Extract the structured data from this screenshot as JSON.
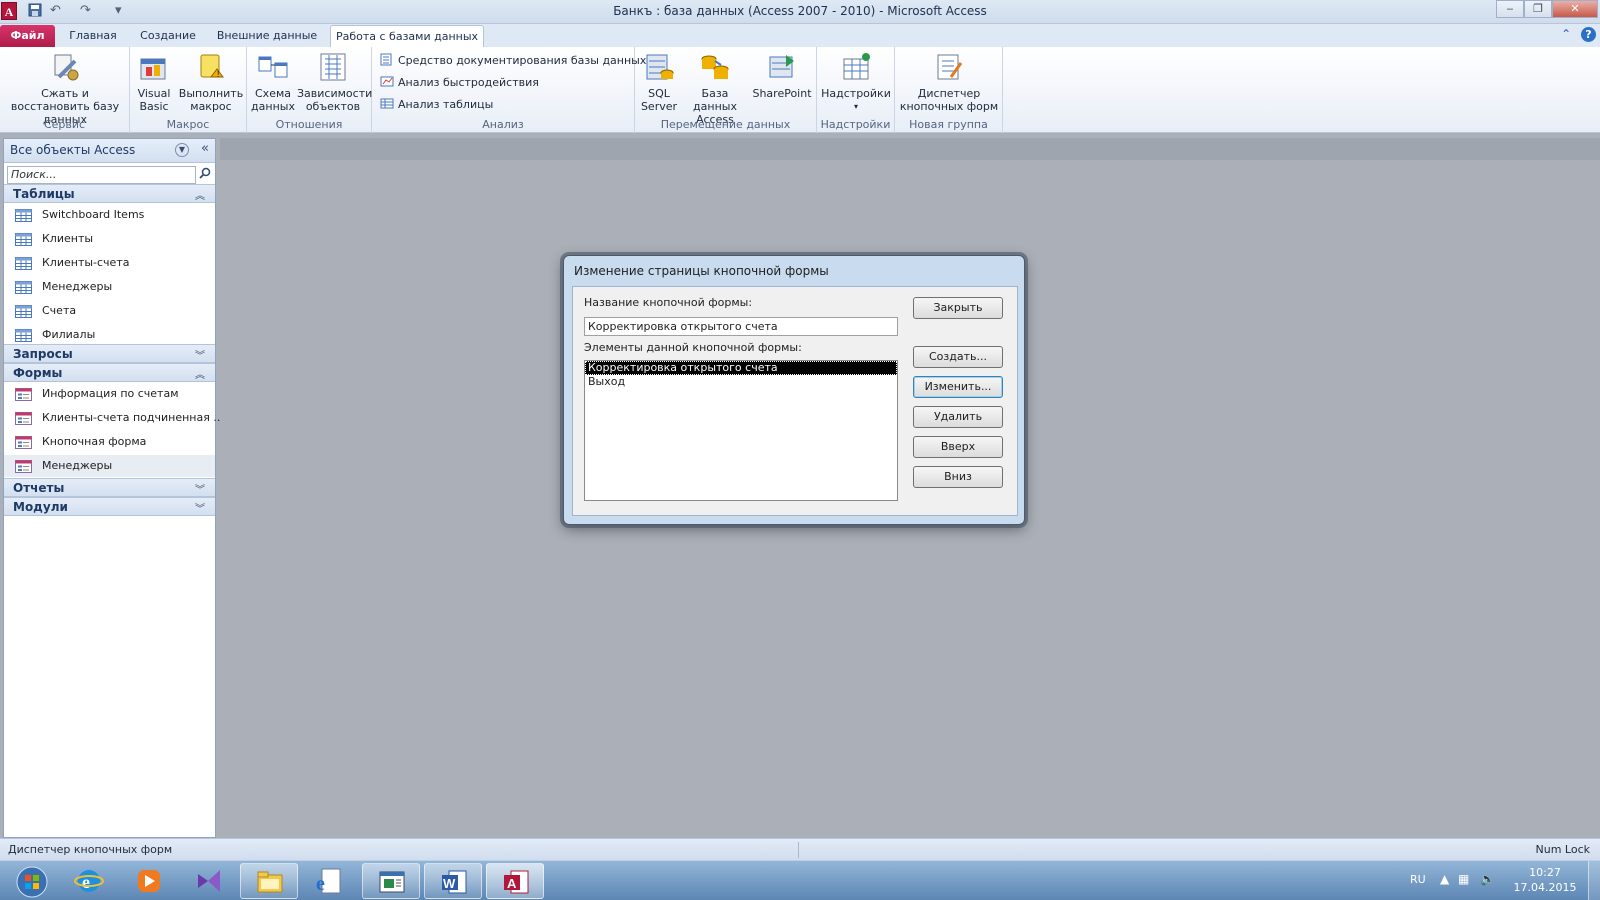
{
  "window": {
    "title": "Банкъ : база данных (Access 2007 - 2010)  -  Microsoft Access",
    "app_icon": "A",
    "controls": {
      "minimize": "‒",
      "restore": "❐",
      "close": "✕"
    }
  },
  "quick_access": {
    "save": "💾",
    "undo": "↶",
    "redo": "↷",
    "customize": "▾"
  },
  "ribbon_tabs": [
    {
      "label": "Файл"
    },
    {
      "label": "Главная"
    },
    {
      "label": "Создание"
    },
    {
      "label": "Внешние данные"
    },
    {
      "label": "Работа с базами данных"
    }
  ],
  "ribbon": {
    "groups": [
      {
        "label": "Сервис",
        "buttons": [
          {
            "label": "Сжать и восстановить базу данных"
          }
        ]
      },
      {
        "label": "Макрос",
        "buttons": [
          {
            "label": "Visual Basic"
          },
          {
            "label": "Выполнить макрос"
          }
        ]
      },
      {
        "label": "Отношения",
        "buttons": [
          {
            "label": "Схема данных"
          },
          {
            "label": "Зависимости объектов"
          }
        ]
      },
      {
        "label": "Анализ",
        "items": [
          {
            "label": "Средство документирования базы данных"
          },
          {
            "label": "Анализ быстродействия"
          },
          {
            "label": "Анализ таблицы"
          }
        ]
      },
      {
        "label": "Перемещение данных",
        "buttons": [
          {
            "label": "SQL Server"
          },
          {
            "label": "База данных Access"
          },
          {
            "label": "SharePoint"
          }
        ]
      },
      {
        "label": "Надстройки",
        "buttons": [
          {
            "label": "Надстройки"
          }
        ]
      },
      {
        "label": "Новая группа",
        "buttons": [
          {
            "label": "Диспетчер кнопочных форм"
          }
        ]
      }
    ]
  },
  "nav_pane": {
    "title": "Все объекты Access",
    "search_placeholder": "Поиск...",
    "sections": [
      {
        "label": "Таблицы",
        "expanded": true,
        "items": [
          "Switchboard Items",
          "Клиенты",
          "Клиенты-счета",
          "Менеджеры",
          "Счета",
          "Филиалы"
        ]
      },
      {
        "label": "Запросы",
        "expanded": false,
        "items": []
      },
      {
        "label": "Формы",
        "expanded": true,
        "items": [
          "Информация по счетам",
          "Клиенты-счета подчиненная ...",
          "Кнопочная форма",
          "Менеджеры"
        ]
      },
      {
        "label": "Отчеты",
        "expanded": false,
        "items": []
      },
      {
        "label": "Модули",
        "expanded": false,
        "items": []
      }
    ],
    "selected_item": "Менеджеры"
  },
  "dialog": {
    "title": "Изменение страницы кнопочной формы",
    "name_label": "Название кнопочной формы:",
    "name_value": "Корректировка открытого счета",
    "items_label": "Элементы данной кнопочной формы:",
    "items": [
      "Корректировка открытого счета",
      "Выход"
    ],
    "selected_index": 0,
    "buttons": {
      "close": "Закрыть",
      "create": "Создать...",
      "edit": "Изменить...",
      "delete": "Удалить",
      "up": "Вверх",
      "down": "Вниз"
    }
  },
  "status_bar": {
    "left": "Диспетчер кнопочных форм",
    "right": "Num Lock"
  },
  "taskbar": {
    "lang": "RU",
    "time": "10:27",
    "date": "17.04.2015"
  },
  "icons": {
    "search": "search-icon",
    "collapse_nav": "double-chevron-left-icon",
    "section_expanded": "chevron-up-icon",
    "section_collapsed": "chevron-down-icon"
  },
  "colors": {
    "file_tab": "#b01e4b",
    "accent": "#1e3a66",
    "dialog_frame": "#c9dbef"
  }
}
